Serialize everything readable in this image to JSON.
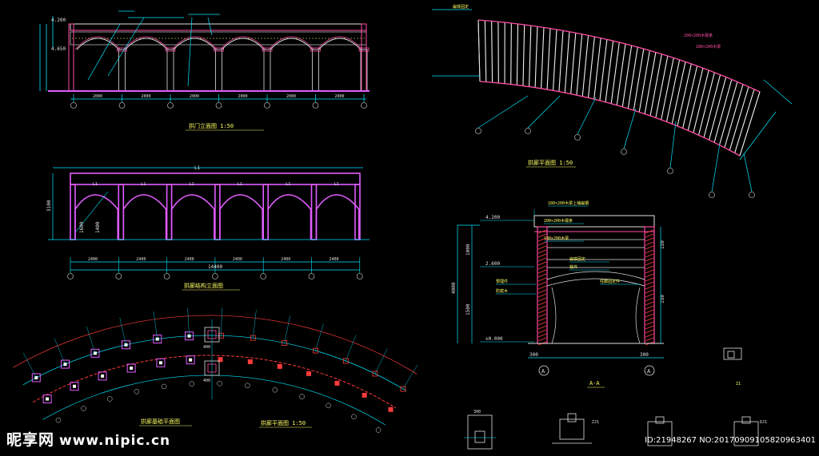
{
  "elevation_top": {
    "title": "拱门立面图 1:50",
    "levels": [
      "4.200",
      "4.650"
    ],
    "dims": [
      "2000",
      "2000",
      "2000",
      "2000",
      "2000",
      "2000"
    ]
  },
  "elevation_mid": {
    "title": "拱廊结构立面图",
    "top_label": "L1",
    "span_labels": [
      "L1",
      "L1",
      "L1",
      "L1",
      "L1",
      "L1"
    ],
    "height_dims": [
      "3100",
      "1600",
      "1400"
    ],
    "dims": [
      "2400",
      "2400",
      "2400",
      "2400",
      "2400",
      "2400"
    ],
    "total": "14400"
  },
  "plan_right": {
    "title": "拱廊平面图 1:50",
    "notes": [
      "200×200木檩条",
      "180×200木梁",
      "扁铁固定"
    ],
    "axes": [
      "1",
      "2",
      "3",
      "4",
      "5",
      "6",
      "7"
    ]
  },
  "plan_bottom": {
    "title_left": "拱廊基础平面图",
    "title_right": "拱廊平面图 1:50",
    "dims": [
      "400",
      "400"
    ]
  },
  "section": {
    "title": "A-A",
    "levels": [
      "4.200",
      "2.600",
      "±0.000",
      "4000"
    ],
    "dims_left": [
      "1000",
      "1500"
    ],
    "dims_right": [
      "150",
      "150"
    ],
    "notes": [
      "180×200木梁上铺扁钢",
      "200×200木檩条",
      "180×200木梁",
      "扁铁固定",
      "铁件",
      "预埋件",
      "柱脚固定件",
      "防腐木"
    ],
    "bottom_dims": [
      "300",
      "300"
    ],
    "axis": "A"
  },
  "details": {
    "labels": [
      "Z1",
      "300",
      "ZJ1",
      "DJ1"
    ]
  },
  "watermark": {
    "brand": "昵享网",
    "url": "www.nipic.cn",
    "id": "ID:21948267 NO:20170909105820963401"
  }
}
